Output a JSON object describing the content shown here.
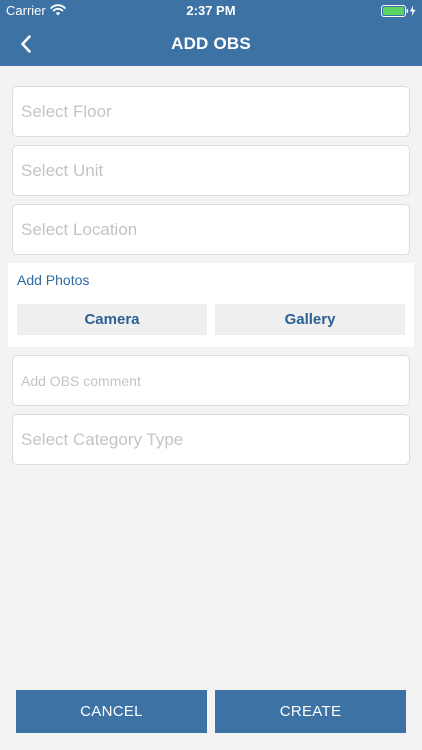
{
  "status_bar": {
    "carrier": "Carrier",
    "time": "2:37 PM",
    "wifi_icon": "wifi-icon",
    "battery_icon": "battery-charging-icon",
    "battery_color": "#5bd463"
  },
  "nav": {
    "title": "ADD OBS",
    "back_icon": "chevron-left-icon",
    "bar_color": "#3d72a4"
  },
  "form": {
    "floor_placeholder": "Select Floor",
    "unit_placeholder": "Select Unit",
    "location_placeholder": "Select Location",
    "photos": {
      "label": "Add Photos",
      "camera_label": "Camera",
      "gallery_label": "Gallery"
    },
    "comment_placeholder": "Add OBS comment",
    "category_placeholder": "Select Category Type"
  },
  "actions": {
    "cancel_label": "CANCEL",
    "create_label": "CREATE",
    "button_color": "#3d72a4"
  }
}
